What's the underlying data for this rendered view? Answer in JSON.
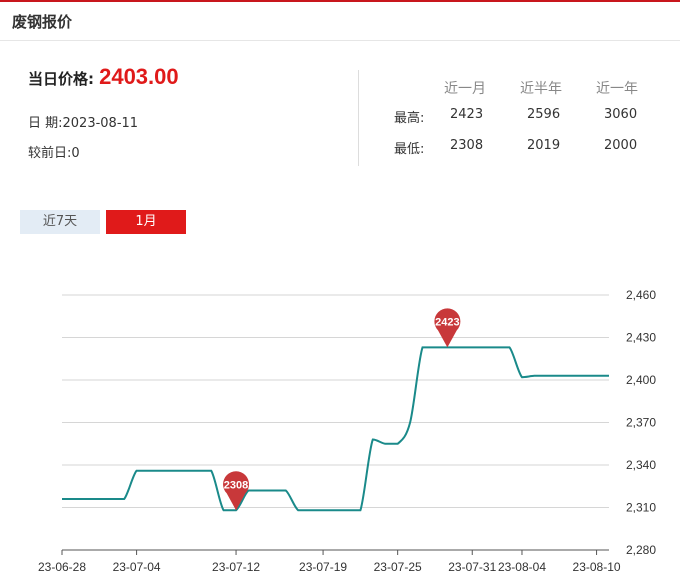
{
  "header": {
    "title": "废钢报价"
  },
  "price": {
    "label": "当日价格:",
    "value": "2403.00"
  },
  "info": {
    "date_line": "日 期:2023-08-11",
    "change_line": "较前日:0"
  },
  "stats": {
    "columns": [
      "近一月",
      "近半年",
      "近一年"
    ],
    "rows": [
      {
        "label": "最高:",
        "values": [
          "2423",
          "2596",
          "3060"
        ]
      },
      {
        "label": "最低:",
        "values": [
          "2308",
          "2019",
          "2000"
        ]
      }
    ]
  },
  "tabs": [
    {
      "label": "近7天",
      "active": false
    },
    {
      "label": "1月",
      "active": true
    }
  ],
  "colors": {
    "accent": "#e01a1a",
    "line": "#1a8a8a",
    "marker": "#c8383a"
  },
  "chart_data": {
    "type": "line",
    "x": [
      "23-06-28",
      "23-06-29",
      "23-06-30",
      "23-07-01",
      "23-07-02",
      "23-07-03",
      "23-07-04",
      "23-07-05",
      "23-07-06",
      "23-07-07",
      "23-07-08",
      "23-07-09",
      "23-07-10",
      "23-07-11",
      "23-07-12",
      "23-07-13",
      "23-07-14",
      "23-07-15",
      "23-07-16",
      "23-07-17",
      "23-07-18",
      "23-07-19",
      "23-07-20",
      "23-07-21",
      "23-07-22",
      "23-07-23",
      "23-07-24",
      "23-07-25",
      "23-07-26",
      "23-07-27",
      "23-07-28",
      "23-07-29",
      "23-07-30",
      "23-07-31",
      "23-08-01",
      "23-08-02",
      "23-08-03",
      "23-08-04",
      "23-08-05",
      "23-08-06",
      "23-08-07",
      "23-08-08",
      "23-08-09",
      "23-08-10",
      "23-08-11"
    ],
    "series": [
      {
        "values": [
          2316,
          2316,
          2316,
          2316,
          2316,
          2316,
          2336,
          2336,
          2336,
          2336,
          2336,
          2336,
          2336,
          2308,
          2308,
          2322,
          2322,
          2322,
          2322,
          2308,
          2308,
          2308,
          2308,
          2308,
          2308,
          2358,
          2355,
          2355,
          2370,
          2423,
          2423,
          2423,
          2423,
          2423,
          2423,
          2423,
          2423,
          2402,
          2403,
          2403,
          2403,
          2403,
          2403,
          2403,
          2403
        ]
      }
    ],
    "xticks": [
      "23-06-28",
      "23-07-04",
      "23-07-12",
      "23-07-19",
      "23-07-25",
      "23-07-31",
      "23-08-04",
      "23-08-10"
    ],
    "yticks": [
      2280,
      2310,
      2340,
      2370,
      2400,
      2430,
      2460
    ],
    "ytick_labels": [
      "2,280",
      "2,310",
      "2,340",
      "2,370",
      "2,400",
      "2,430",
      "2,460"
    ],
    "ylim": [
      2280,
      2460
    ],
    "grid": true,
    "y_axis_position": "right",
    "annotations": [
      {
        "x": "23-07-12",
        "y": 2308,
        "label": "2308",
        "kind": "min"
      },
      {
        "x": "23-07-29",
        "y": 2423,
        "label": "2423",
        "kind": "max"
      }
    ]
  }
}
